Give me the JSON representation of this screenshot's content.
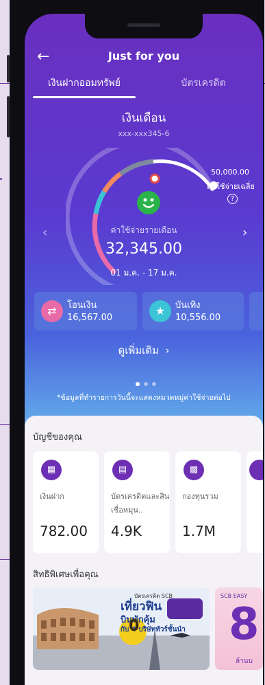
{
  "header": {
    "title": "Just for you",
    "back_icon": "arrow-left-icon"
  },
  "tabs": [
    {
      "label": "เงินฝากออมทรัพย์",
      "active": true
    },
    {
      "label": "บัตรเครดิต",
      "active": false
    }
  ],
  "account": {
    "name": "เงินเดือน",
    "number": "xxx-xxx345-6"
  },
  "gauge": {
    "average_amount": "50,000.00",
    "average_label": "ค่าใช้จ่ายเฉลี่ย",
    "month_label": "ค่าใช้จ่ายรายเดือน",
    "month_amount": "32,345.00",
    "date_range": "01 ม.ค. - 17 ม.ค.",
    "progress": 0.65
  },
  "categories": [
    {
      "name": "โอนเงิน",
      "value": "16,567.00",
      "icon": "shuffle-icon",
      "color": "#e86aa8"
    },
    {
      "name": "บันเทิง",
      "value": "10,556.00",
      "icon": "popcorn-icon",
      "color": "#3bc3d6"
    }
  ],
  "see_more": "ดูเพิ่มเติม",
  "disclaimer": "*ข้อมูลที่ทำรายการวันนี้จะแสดงหมวดหมู่ค่าใช้จ่ายต่อไป",
  "accounts_section": {
    "title": "บัญชีของคุณ",
    "cards": [
      {
        "name": "เงินฝาก",
        "value": "782.00",
        "icon": "deposit-icon"
      },
      {
        "name": "บัตรเครดิตและสินเชื่อหมุน..",
        "value": "4.9K",
        "icon": "credit-card-icon"
      },
      {
        "name": "กองทุนรวม",
        "value": "1.7M",
        "icon": "fund-icon"
      }
    ]
  },
  "privileges_section": {
    "title": "สิทธิพิเศษเพื่อคุณ",
    "promo_tag": "บัตรเครดิต SCB",
    "promo_headline": "เที่ยวฟิน",
    "promo_line2": "บินพักคุ้ม",
    "promo_line3": "กับ 4 บริษัททัวร์ชั้นนำ",
    "promo_badge": "0",
    "promo2_tag": "SCB EASY",
    "promo2_big": "8",
    "promo2_small": "ล้านบ"
  },
  "colors": {
    "brand": "#6d2fb3",
    "good": "#29b34a"
  }
}
